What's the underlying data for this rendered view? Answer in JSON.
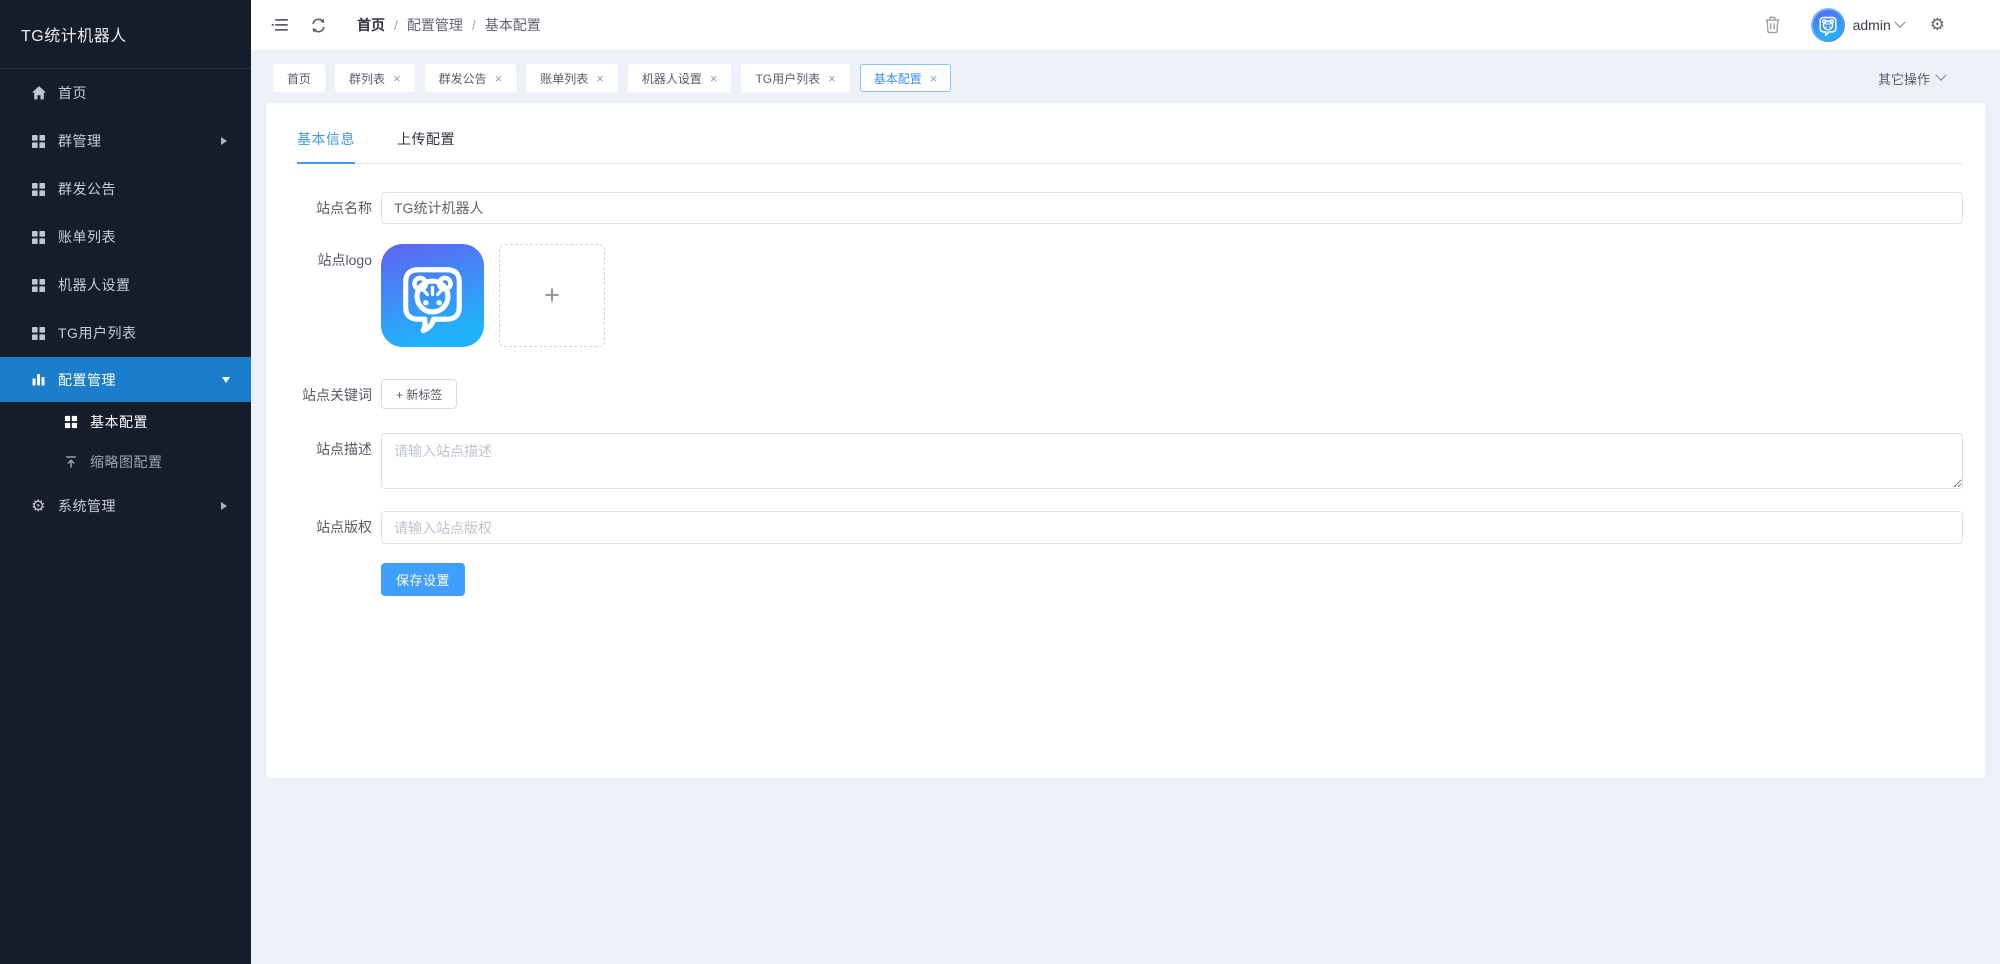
{
  "app_title": "TG统计机器人",
  "sidebar": {
    "logo": "TG统计机器人",
    "items": [
      {
        "label": "首页",
        "icon": "home-icon"
      },
      {
        "label": "群管理",
        "icon": "grid-icon",
        "arrow": "right"
      },
      {
        "label": "群发公告",
        "icon": "grid-icon"
      },
      {
        "label": "账单列表",
        "icon": "grid-icon"
      },
      {
        "label": "机器人设置",
        "icon": "grid-icon"
      },
      {
        "label": "TG用户列表",
        "icon": "grid-icon"
      },
      {
        "label": "配置管理",
        "icon": "bar-chart-icon",
        "arrow": "down",
        "active": true
      },
      {
        "label": "基本配置",
        "icon": "grid-icon",
        "sub": true,
        "current": true
      },
      {
        "label": "缩略图配置",
        "icon": "upload-icon",
        "sub": true
      },
      {
        "label": "系统管理",
        "icon": "gear-icon",
        "arrow": "right"
      }
    ]
  },
  "header": {
    "breadcrumb": [
      "首页",
      "配置管理",
      "基本配置"
    ],
    "user": "admin"
  },
  "tabbar": {
    "tabs": [
      {
        "label": "首页",
        "closable": false
      },
      {
        "label": "群列表",
        "closable": true
      },
      {
        "label": "群发公告",
        "closable": true
      },
      {
        "label": "账单列表",
        "closable": true
      },
      {
        "label": "机器人设置",
        "closable": true
      },
      {
        "label": "TG用户列表",
        "closable": true
      },
      {
        "label": "基本配置",
        "closable": true,
        "active": true
      }
    ],
    "more_label": "其它操作"
  },
  "content": {
    "tabs": [
      {
        "label": "基本信息",
        "active": true
      },
      {
        "label": "上传配置"
      }
    ],
    "form": {
      "site_name": {
        "label": "站点名称",
        "value": "TG统计机器人"
      },
      "site_logo": {
        "label": "站点logo"
      },
      "site_keywords": {
        "label": "站点关键词",
        "new_tag_label": "+ 新标签"
      },
      "site_desc": {
        "label": "站点描述",
        "placeholder": "请输入站点描述"
      },
      "site_copyright": {
        "label": "站点版权",
        "placeholder": "请输入站点版权"
      },
      "save_label": "保存设置"
    }
  },
  "glyphs": {
    "close": "×",
    "plus": "+",
    "slash": "/",
    "gear": "⚙"
  },
  "colors": {
    "accent": "#409eff",
    "sidebar_bg": "#161d2a",
    "sidebar_active_bg": "#1a7ecd",
    "active_tab_text": "#3f8ef2",
    "page_bg": "#eef1f7",
    "logo_gradient_start": "#5f63f2",
    "logo_gradient_end": "#21b3f9"
  }
}
